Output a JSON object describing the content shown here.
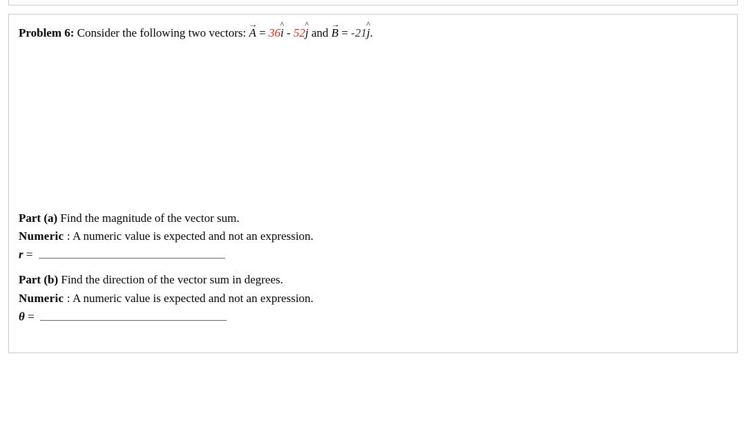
{
  "problem": {
    "label": "Problem 6:",
    "intro": "  Consider the following two vectors: ",
    "vectorA_sym": "A",
    "equals1": " = ",
    "Ax": "36",
    "ihat": "i",
    "sep1": " - ",
    "Ay": "52",
    "jhat1": "j",
    "and_text": " and ",
    "vectorB_sym": "B",
    "equals2": " = ",
    "Bx": "-21",
    "jhat2": "j",
    "period": "."
  },
  "partA": {
    "label": "Part (a) ",
    "prompt": "Find the magnitude of the vector sum.",
    "numeric_label": "Numeric   ",
    "numeric_text": ": A numeric value is expected and not an expression.",
    "var": "r",
    "eq": " = "
  },
  "partB": {
    "label": "Part (b) ",
    "prompt": "Find the direction of the vector sum in degrees.",
    "numeric_label": "Numeric   ",
    "numeric_text": ": A numeric value is expected and not an expression.",
    "var": "θ",
    "eq": " = "
  }
}
